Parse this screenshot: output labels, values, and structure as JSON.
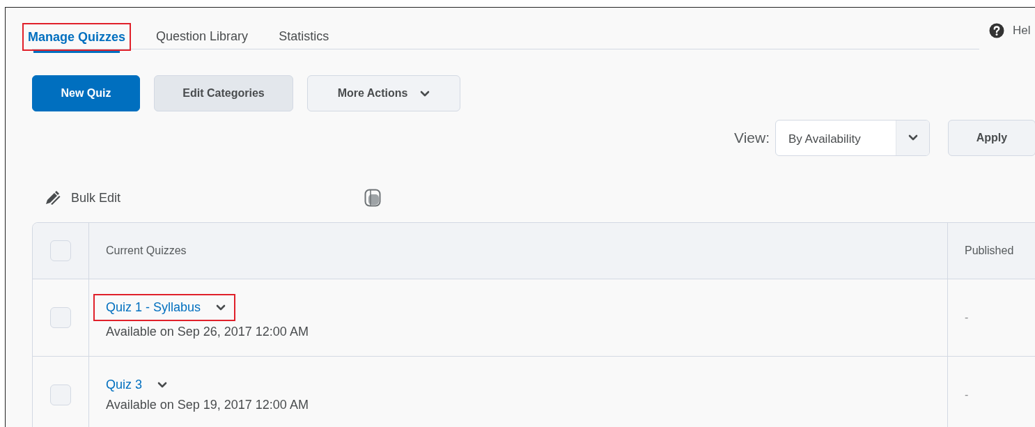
{
  "tabs": [
    {
      "label": "Manage Quizzes",
      "selected": true,
      "annotated": true
    },
    {
      "label": "Question Library",
      "selected": false,
      "annotated": false
    },
    {
      "label": "Statistics",
      "selected": false,
      "annotated": false
    }
  ],
  "help": {
    "label": "Hel"
  },
  "actions": [
    {
      "label": "New Quiz",
      "kind": "primary"
    },
    {
      "label": "Edit Categories",
      "kind": "secondary"
    },
    {
      "label": "More Actions",
      "kind": "dropdown"
    }
  ],
  "view": {
    "label": "View:",
    "value": "By Availability",
    "apply": "Apply"
  },
  "bulk_edit": {
    "label": "Bulk Edit"
  },
  "table": {
    "select_all": {
      "checked": false
    },
    "columns": [
      "Current Quizzes",
      "Published"
    ],
    "rows": [
      {
        "title": "Quiz 1 - Syllabus",
        "availability": "Available on Sep 26, 2017 12:00 AM",
        "published": "-",
        "checked": false,
        "annotated": true
      },
      {
        "title": "Quiz 3",
        "availability": "Available on Sep 19, 2017 12:00 AM",
        "published": "-",
        "checked": false,
        "annotated": false
      }
    ]
  }
}
